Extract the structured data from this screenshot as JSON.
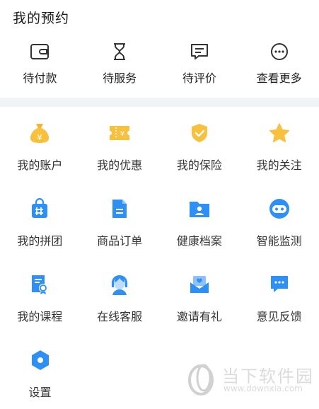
{
  "header": {
    "title": "我的预约"
  },
  "orders": [
    {
      "label": "待付款",
      "icon": "wallet-icon"
    },
    {
      "label": "待服务",
      "icon": "hourglass-icon"
    },
    {
      "label": "待评价",
      "icon": "comment-icon"
    },
    {
      "label": "查看更多",
      "icon": "more-icon"
    }
  ],
  "menu": [
    {
      "label": "我的账户",
      "icon": "money-bag-icon",
      "color": "#f7c13e"
    },
    {
      "label": "我的优惠",
      "icon": "coupon-icon",
      "color": "#f7c13e"
    },
    {
      "label": "我的保险",
      "icon": "shield-icon",
      "color": "#f7c13e"
    },
    {
      "label": "我的关注",
      "icon": "star-icon",
      "color": "#f7c13e"
    },
    {
      "label": "我的拼团",
      "icon": "group-bag-icon",
      "color": "#2e8ff5"
    },
    {
      "label": "商品订单",
      "icon": "order-doc-icon",
      "color": "#2e8ff5"
    },
    {
      "label": "健康档案",
      "icon": "folder-user-icon",
      "color": "#2e8ff5"
    },
    {
      "label": "智能监测",
      "icon": "robot-icon",
      "color": "#2e8ff5"
    },
    {
      "label": "我的课程",
      "icon": "certificate-icon",
      "color": "#2e8ff5"
    },
    {
      "label": "在线客服",
      "icon": "service-agent-icon",
      "color": "#2e8ff5"
    },
    {
      "label": "邀请有礼",
      "icon": "invite-mail-icon",
      "color": "#2e8ff5"
    },
    {
      "label": "意见反馈",
      "icon": "feedback-chat-icon",
      "color": "#2e8ff5"
    },
    {
      "label": "设置",
      "icon": "settings-hex-icon",
      "color": "#2e8ff5"
    }
  ],
  "watermark": {
    "text": "当下软件园",
    "url": "www.downxia.com"
  }
}
